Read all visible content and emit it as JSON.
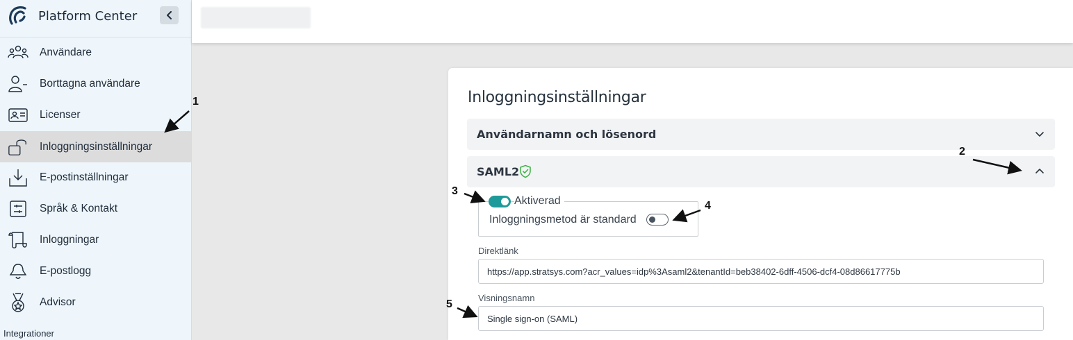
{
  "sidebar": {
    "brand": "Platform Center",
    "items": [
      {
        "label": "Användare",
        "icon": "users-icon"
      },
      {
        "label": "Borttagna användare",
        "icon": "user-minus-icon"
      },
      {
        "label": "Licenser",
        "icon": "id-card-icon"
      },
      {
        "label": "Inloggningsinställningar",
        "icon": "unlock-icon",
        "active": true
      },
      {
        "label": "E-postinställningar",
        "icon": "download-tray-icon"
      },
      {
        "label": "Språk & Kontakt",
        "icon": "sliders-icon"
      },
      {
        "label": "Inloggningar",
        "icon": "scroll-icon"
      },
      {
        "label": "E-postlogg",
        "icon": "bell-icon"
      },
      {
        "label": "Advisor",
        "icon": "medal-icon"
      }
    ],
    "section_label": "Integrationer"
  },
  "card": {
    "title": "Inloggningsinställningar",
    "accordions": [
      {
        "title": "Användarnamn och lösenord",
        "expanded": false
      },
      {
        "title": "SAML2",
        "expanded": true,
        "verified": true
      }
    ],
    "saml": {
      "enabled_label": "Aktiverad",
      "enabled": true,
      "default_label": "Inloggningsmetod är standard",
      "default": false,
      "direct_link_label": "Direktlänk",
      "direct_link_value": "https://app.stratsys.com?acr_values=idp%3Asaml2&tenantId=beb38402-6dff-4506-dcf4-08d86617775b",
      "display_name_label": "Visningsnamn",
      "display_name_value": "Single sign-on (SAML)"
    }
  },
  "annotations": [
    "1",
    "2",
    "3",
    "4",
    "5"
  ],
  "colors": {
    "accent": "#1f9a9a",
    "shield": "#3cb043",
    "sidebar_bg": "#eef6fb"
  }
}
